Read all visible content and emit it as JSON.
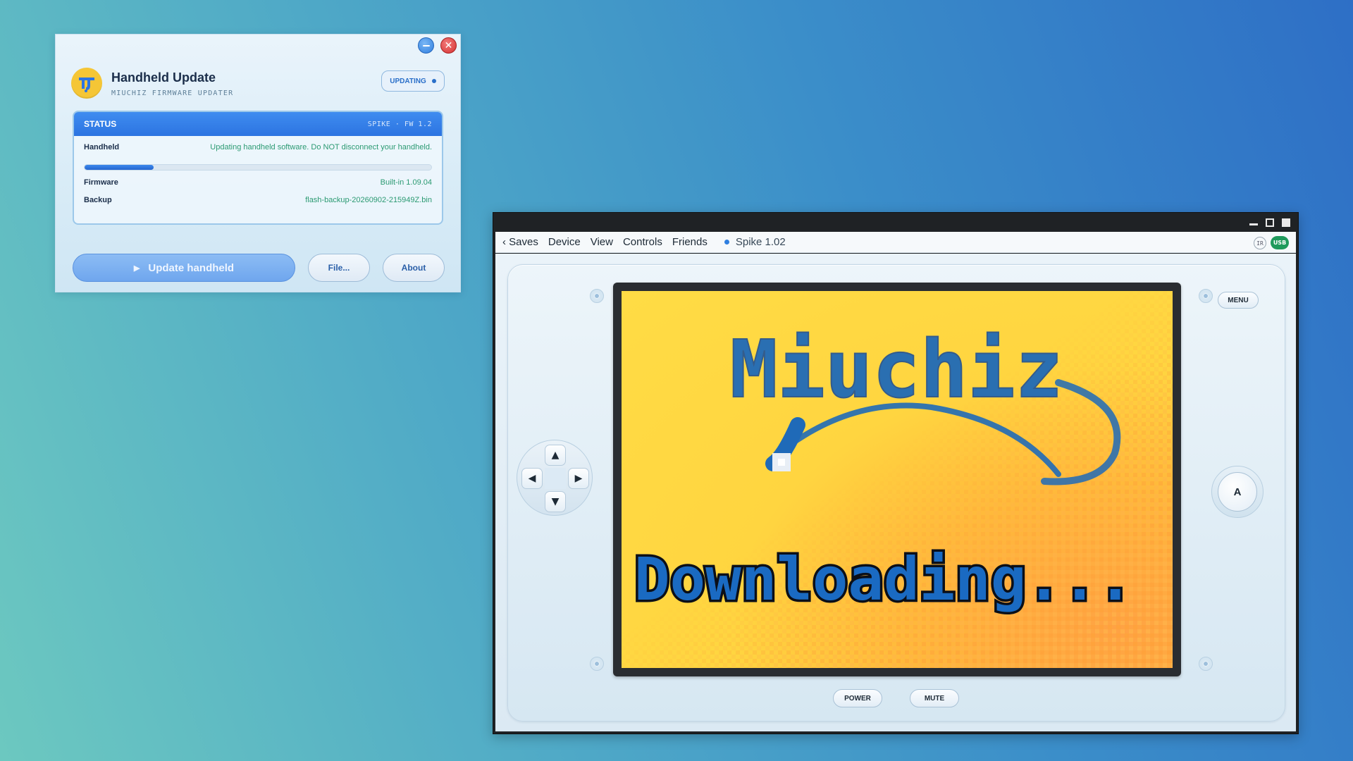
{
  "updater": {
    "title": "Handheld Update",
    "subtitle": "MIUCHIZ FIRMWARE UPDATER",
    "state_badge": "UPDATING",
    "status": {
      "header_label": "STATUS",
      "device_fw": "SPIKE · FW 1.2",
      "handheld_label": "Handheld",
      "handheld_message": "Updating handheld software. Do NOT disconnect your handheld.",
      "progress_percent": 20,
      "firmware_label": "Firmware",
      "firmware_value": "Built-in 1.09.04",
      "backup_label": "Backup",
      "backup_value": "flash-backup-20260902-215949Z.bin"
    },
    "actions": {
      "primary": "Update handheld",
      "file": "File...",
      "about": "About"
    }
  },
  "emulator": {
    "menu": {
      "saves": "‹ Saves",
      "device": "Device",
      "view": "View",
      "controls": "Controls",
      "friends": "Friends"
    },
    "device_title": "Spike 1.02",
    "indicators": {
      "ir": "IR",
      "usb": "USB"
    },
    "screen_text": {
      "logo": "Miuchiz",
      "status": "Downloading..."
    },
    "buttons": {
      "menu": "MENU",
      "a": "A",
      "power": "POWER",
      "mute": "MUTE"
    },
    "dpad": {
      "up": "▲",
      "down": "▼",
      "left": "◀",
      "right": "▶"
    }
  },
  "colors": {
    "accent": "#2c74e1",
    "status_green": "#2b9a72",
    "screen_yellow": "#ffd540",
    "screen_orange": "#ffa244",
    "pixel_blue": "#1f6ab8"
  }
}
